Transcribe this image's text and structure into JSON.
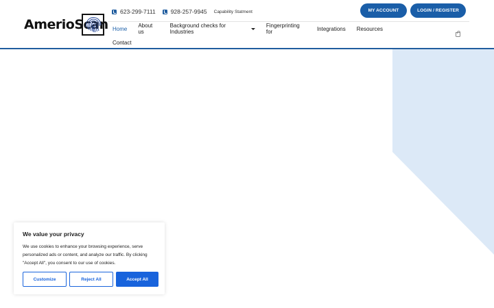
{
  "logo": {
    "text": "AmerioScan"
  },
  "contact": {
    "phone1": "623-299-7111",
    "phone2": "928-257-9945",
    "capability_link": "Capability Statment"
  },
  "account_buttons": {
    "my_account": "MY ACCOUNT",
    "login_register": "LOGIN / REGISTER"
  },
  "nav": {
    "items": [
      {
        "label": "Home",
        "active": true
      },
      {
        "label": "About us"
      },
      {
        "label": "Background checks for Industries",
        "has_dropdown": true
      },
      {
        "label": "Fingerprinting for"
      },
      {
        "label": "Integrations"
      },
      {
        "label": "Resources"
      },
      {
        "label": "Contact"
      }
    ]
  },
  "cookie_banner": {
    "title": "We value your privacy",
    "text": "We use cookies to enhance your browsing experience, serve personalized ads or content, and analyze our traffic. By clicking \"Accept All\", you consent to our use of cookies.",
    "customize": "Customize",
    "reject": "Reject All",
    "accept": "Accept All"
  },
  "colors": {
    "brand": "#1a5ea8",
    "cookie_accent": "#1863dc",
    "deco_shape": "#dce9f7"
  },
  "icons": [
    "phone-icon",
    "fingerprint-icon",
    "cart-icon",
    "chevron-down-icon"
  ]
}
